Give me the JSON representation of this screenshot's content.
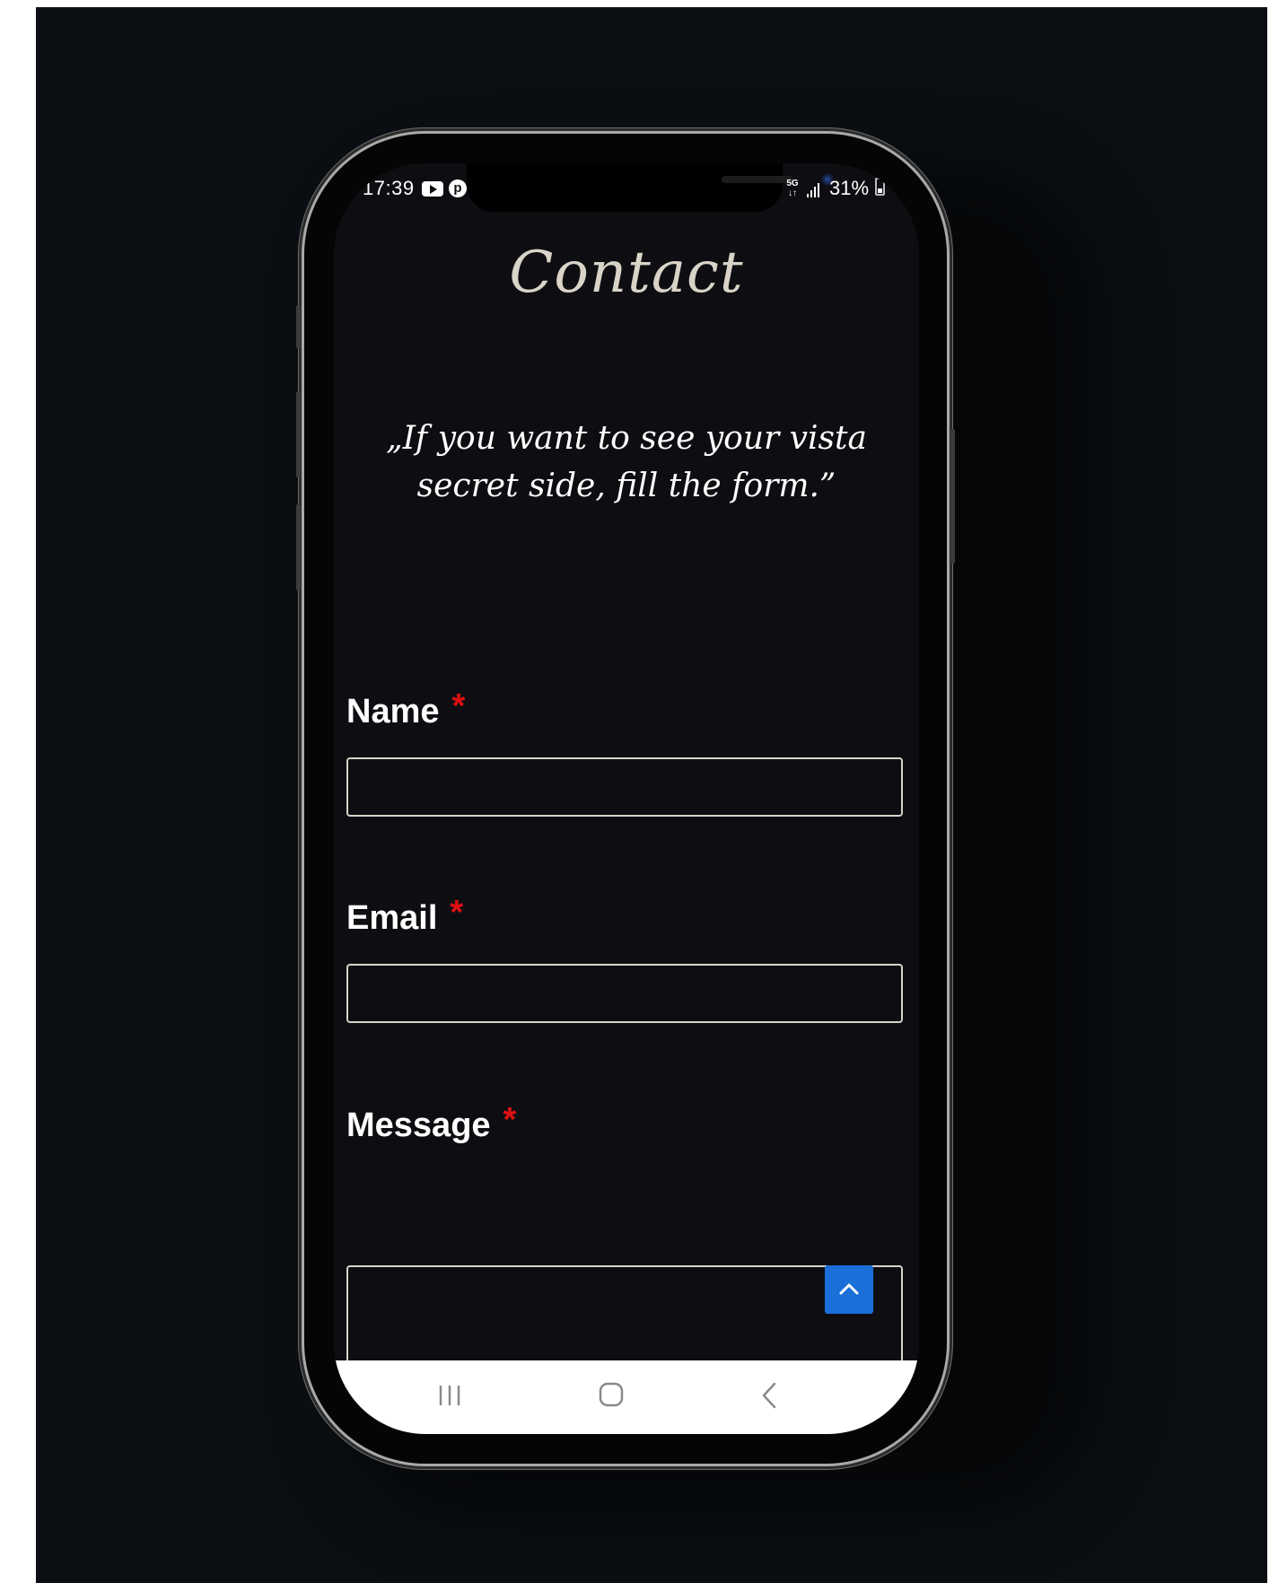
{
  "status_bar": {
    "time": "17:39",
    "battery_percent": "31%",
    "network_label": "5G",
    "icons": [
      "youtube-icon",
      "pinterest-icon",
      "network-5g-icon",
      "signal-icon",
      "battery-icon"
    ]
  },
  "page": {
    "title": "Contact",
    "quote": "„If you want to see your vista secret side, fill the form.”"
  },
  "form": {
    "required_marker": "*",
    "fields": [
      {
        "label": "Name",
        "value": "",
        "placeholder": ""
      },
      {
        "label": "Email",
        "value": "",
        "placeholder": ""
      },
      {
        "label": "Message",
        "value": "",
        "placeholder": ""
      }
    ]
  },
  "navigation": {
    "buttons": [
      "recent-apps-icon",
      "home-icon",
      "back-icon"
    ]
  },
  "colors": {
    "background": "#0b0f13",
    "screen_background": "#0e0e12",
    "title_text": "#d9d4c8",
    "required_marker": "#e01010",
    "accent": "#1a6fd8",
    "nav_bar": "#ffffff"
  }
}
